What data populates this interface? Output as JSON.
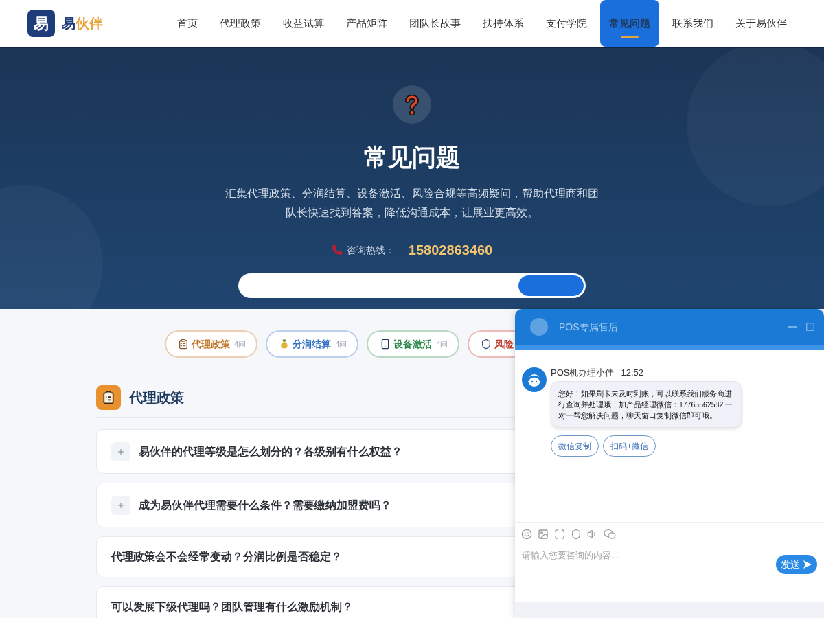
{
  "header": {
    "logo_mark": "易",
    "brand": "易",
    "brand_accent": "伙伴",
    "nav": [
      {
        "label": "首页",
        "selected": false
      },
      {
        "label": "代理政策",
        "selected": false
      },
      {
        "label": "收益试算",
        "selected": false
      },
      {
        "label": "产品矩阵",
        "selected": false
      },
      {
        "label": "团队长故事",
        "selected": false
      },
      {
        "label": "扶持体系",
        "selected": false
      },
      {
        "label": "支付学院",
        "selected": false
      },
      {
        "label": "常见问题",
        "selected": true
      },
      {
        "label": "联系我们",
        "selected": false
      },
      {
        "label": "关于易伙伴",
        "selected": false
      }
    ]
  },
  "hero": {
    "title": "常见问题",
    "description": "汇集代理政策、分润结算、设备激活、风险合规等高频疑问，帮助代理商和团队长快速找到答案，降低沟通成本，让展业更高效。",
    "hotline_label": "咨询热线：",
    "hotline_number": "15802863460"
  },
  "categories": [
    {
      "kind": "clipboard",
      "label": "代理政策",
      "count": "4问",
      "color": "#c0701f"
    },
    {
      "kind": "money-bag",
      "label": "分润结算",
      "count": "4问",
      "color": "#2f6fc4"
    },
    {
      "kind": "phone",
      "label": "设备激活",
      "count": "4问",
      "color": "#2e8a4e"
    },
    {
      "kind": "shield",
      "label": "风险",
      "color": "#c0392b"
    }
  ],
  "section": {
    "title": "代理政策",
    "questions": [
      {
        "kind": "toggle",
        "text": "易伙伴的代理等级是怎么划分的？各级别有什么权益？"
      },
      {
        "kind": "toggle",
        "text": "成为易伙伴代理需要什么条件？需要缴纳加盟费吗？"
      },
      {
        "kind": "plain",
        "text": "代理政策会不会经常变动？分润比例是否稳定？"
      },
      {
        "kind": "plain",
        "text": "可以发展下级代理吗？团队管理有什么激励机制？"
      }
    ]
  },
  "chat": {
    "title": "POS专属售后",
    "agent": "POS机办理小佳",
    "time": "12:52",
    "message": "您好！如果刷卡未及时到账，可以联系我们服务商进行查询并处理哦，加产品经理微信：17765562582 一对一帮您解决问题，聊天窗口复制微信即可哦。",
    "actions": [
      "微信复制",
      "扫码+微信"
    ],
    "placeholder": "请输入您要咨询的内容...",
    "send": "发送"
  }
}
